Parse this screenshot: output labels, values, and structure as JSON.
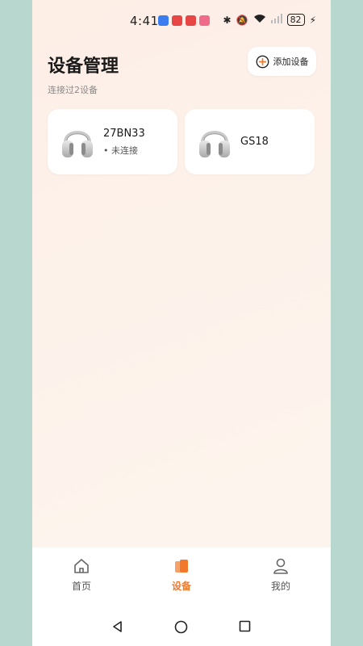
{
  "status_bar": {
    "time": "4:41",
    "battery": "82",
    "icons": [
      "app-icon-blue",
      "app-icon-red",
      "app-icon-red",
      "app-icon-pink",
      "bluetooth-icon",
      "mute-icon",
      "wifi-icon",
      "signal-icon",
      "charging-icon"
    ]
  },
  "header": {
    "title": "设备管理",
    "subtitle": "连接过2设备",
    "add_button_label": "添加设备"
  },
  "devices": [
    {
      "name": "27BN33",
      "status": "• 未连接",
      "icon": "headphones-icon"
    },
    {
      "name": "GS18",
      "status": "",
      "icon": "headphones-icon"
    }
  ],
  "tabbar": {
    "tabs": [
      {
        "label": "首页",
        "icon": "home-icon",
        "active": false
      },
      {
        "label": "设备",
        "icon": "devices-icon",
        "active": true
      },
      {
        "label": "我的",
        "icon": "profile-icon",
        "active": false
      }
    ]
  },
  "navbar": {
    "buttons": [
      "back-icon",
      "home-circle-icon",
      "recents-icon"
    ]
  },
  "colors": {
    "accent": "#f2792b",
    "background_outer": "#b8d8cf",
    "card": "#ffffff"
  }
}
